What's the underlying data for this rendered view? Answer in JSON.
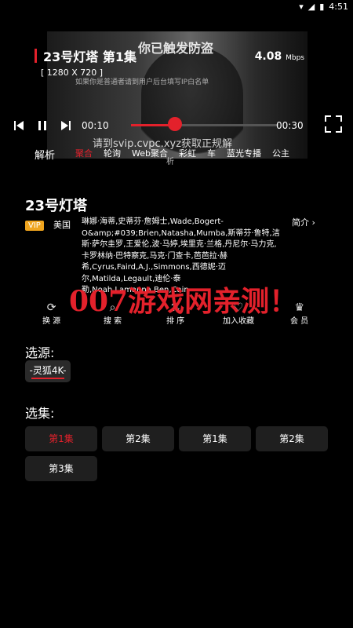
{
  "status": {
    "time": "4:51"
  },
  "player": {
    "title": "23号灯塔 第1集",
    "speed_value": "4.08",
    "speed_unit": "Mbps",
    "resolution": "[ 1280 X 720 ]",
    "current_time": "00:10",
    "total_time": "00:30",
    "progress_fraction": 0.3,
    "watermark_top": "你已触发防盗",
    "watermark_mid": "如果你是普通者请到用户后台填写IP白名单",
    "watermark_bottom": "请到svip.cvpc.xyz获取正规解",
    "watermark_extra": "析",
    "analysis_label": "解析",
    "chips": [
      "聚合",
      "轮询",
      "Web聚合",
      "彩虹",
      "车",
      "蓝光专播",
      "公主"
    ]
  },
  "drama": {
    "title": "23号灯塔",
    "vip_badge": "VIP",
    "region": "美国",
    "cast": "琳娜·海蒂,史蒂芬·詹姆士,Wade,Bogert-O&amp;#039;Brien,Natasha,Mumba,斯蒂芬·鲁特,洁斯·萨尔圭罗,王爱伦,波·马婷,埃里克·兰格,丹尼尔·马力克,卡罗林纳·巴特察克,马克·门查卡,芭芭拉·赫希,Cyrus,Faird,A.J.,Simmons,西德妮·迈尔,Matilda,Legault,迪伦·泰勒,Noah,Lamanna,Ben,Cain",
    "intro_label": "简介"
  },
  "actions": {
    "switch_label": "换 源",
    "search_label": "搜 索",
    "sort_label": "排 序",
    "favorite_label": "加入收藏",
    "member_label": "会 员"
  },
  "overlay_text": "007游戏网亲测！",
  "source": {
    "label": "选源:",
    "current": "-灵狐4K-"
  },
  "episodes": {
    "label": "选集:",
    "items": [
      "第1集",
      "第2集",
      "第1集",
      "第2集",
      "第3集"
    ]
  },
  "colors": {
    "accent": "#e3212b",
    "vip": "#f0a51e"
  }
}
